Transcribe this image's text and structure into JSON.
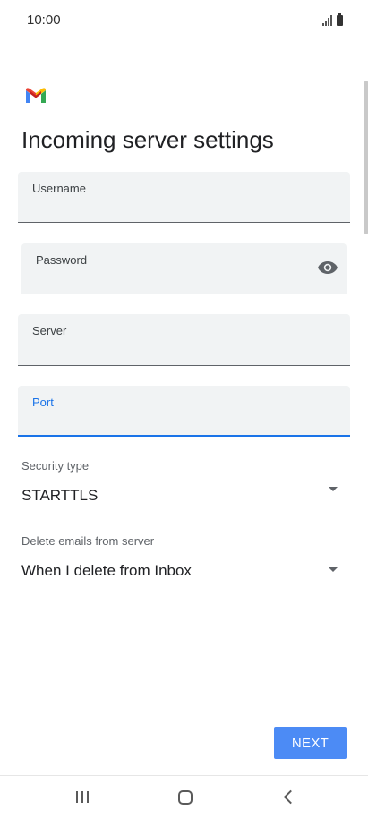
{
  "status_bar": {
    "time": "10:00",
    "icons": [
      "signal-icon",
      "battery-icon"
    ]
  },
  "header": {
    "logo": "gmail-logo",
    "title": "Incoming server settings"
  },
  "form": {
    "username": {
      "label": "Username",
      "value": ""
    },
    "password": {
      "label": "Password",
      "value": "",
      "toggle_icon": "eye-icon"
    },
    "server": {
      "label": "Server",
      "value": ""
    },
    "port": {
      "label": "Port",
      "value": "",
      "state": "focused"
    },
    "security_type": {
      "label": "Security type",
      "value": "STARTTLS"
    },
    "delete_emails": {
      "label": "Delete emails from server",
      "value": "When I delete from Inbox"
    }
  },
  "actions": {
    "next_label": "NEXT"
  },
  "nav_bar": {
    "icons": [
      "recents-icon",
      "home-icon",
      "back-icon"
    ]
  },
  "colors": {
    "accent": "#1a73e8",
    "button": "#4c8bf5",
    "field_background": "#f1f3f4"
  }
}
